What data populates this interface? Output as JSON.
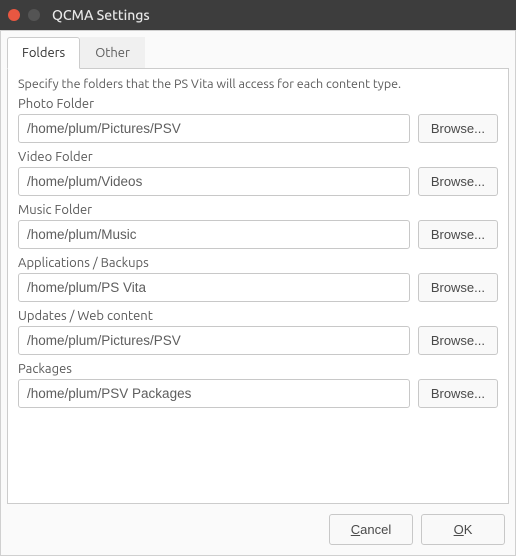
{
  "window": {
    "title": "QCMA Settings"
  },
  "tabs": {
    "folders": "Folders",
    "other": "Other"
  },
  "panel": {
    "description": "Specify the folders that the PS Vita will access for each content type.",
    "browse_label": "Browse...",
    "fields": {
      "photo": {
        "label": "Photo Folder",
        "value": "/home/plum/Pictures/PSV"
      },
      "video": {
        "label": "Video Folder",
        "value": "/home/plum/Videos"
      },
      "music": {
        "label": "Music Folder",
        "value": "/home/plum/Music"
      },
      "apps": {
        "label": "Applications / Backups",
        "value": "/home/plum/PS Vita"
      },
      "updates": {
        "label": "Updates / Web content",
        "value": "/home/plum/Pictures/PSV"
      },
      "packages": {
        "label": "Packages",
        "value": "/home/plum/PSV Packages"
      }
    }
  },
  "footer": {
    "cancel": "Cancel",
    "ok": "OK",
    "cancel_mnemonic_index": 0,
    "ok_mnemonic_index": 0
  }
}
